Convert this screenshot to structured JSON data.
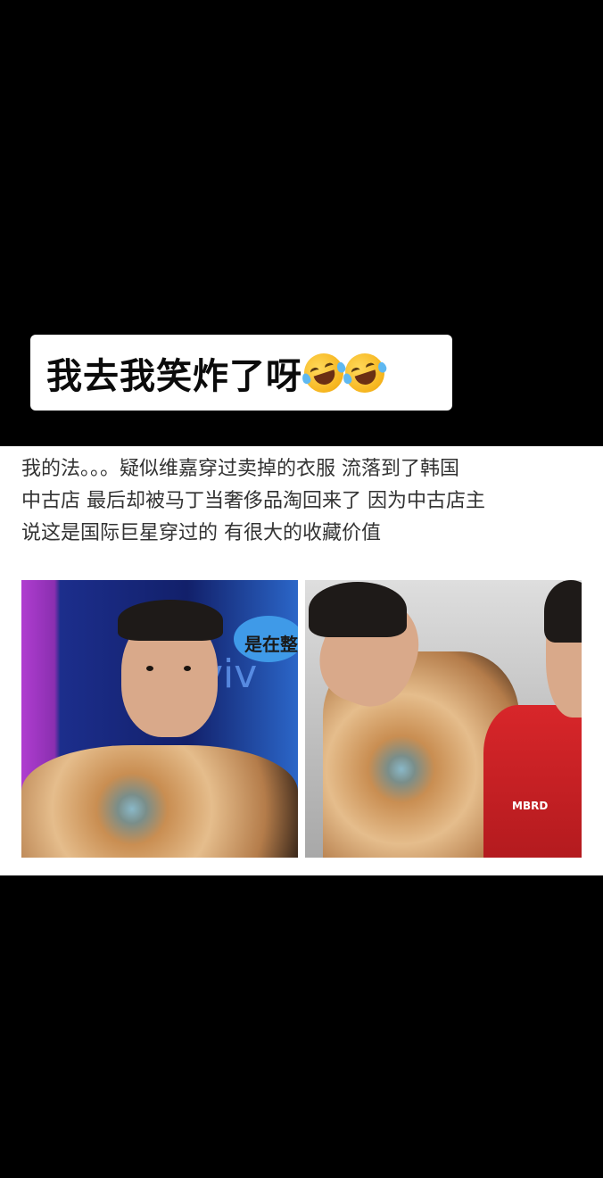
{
  "caption": {
    "text": "我去我笑炸了呀",
    "emojis": [
      "rolling-on-floor-laughing",
      "rolling-on-floor-laughing"
    ]
  },
  "post": {
    "lines": [
      "我的法。。。疑似维嘉穿过卖掉的衣服 流落到了韩国",
      "中古店 最后却被马丁当奢侈品淘回来了 因为中古店主",
      "说这是国际巨星穿过的 有很大的收藏价值"
    ]
  },
  "photos": {
    "left": {
      "bubble_text": "是在整",
      "logo_text": "viv"
    },
    "right": {
      "jersey_text": "MBRD"
    }
  },
  "colors": {
    "background": "#000000",
    "caption_bg": "#ffffff",
    "post_bg": "#ffffff",
    "text": "#333333"
  }
}
